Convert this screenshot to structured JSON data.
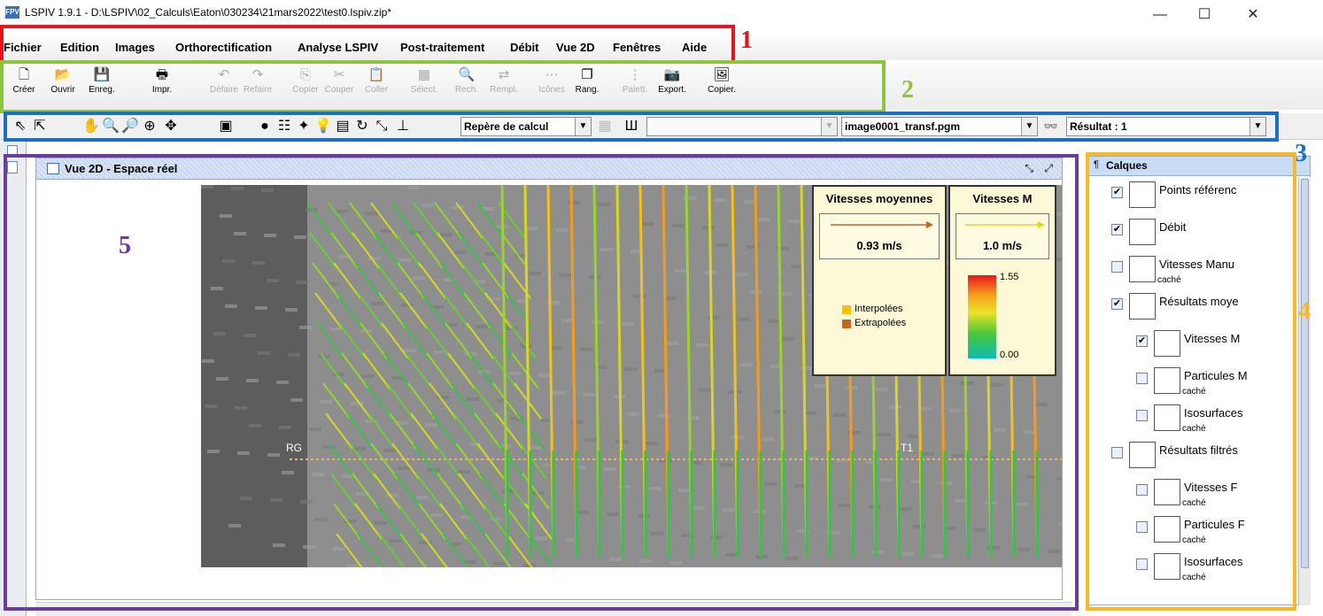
{
  "window": {
    "title": "LSPIV 1.9.1 - D:\\LSPIV\\02_Calculs\\Eaton\\030234\\21mars2022\\test0.lspiv.zip*",
    "logo_text": "FPV",
    "minimize": "—",
    "maximize": "☐",
    "close": "✕"
  },
  "menu": [
    "Fichier",
    "Edition",
    "Images",
    "Orthorectification",
    "Analyse LSPIV",
    "Post-traitement",
    "Débit",
    "Vue 2D",
    "Fenêtres",
    "Aide"
  ],
  "toolbar": [
    {
      "label": "Créer",
      "icon": "new-file-icon",
      "glyph": "🗋",
      "enabled": true
    },
    {
      "label": "Ouvrir",
      "icon": "open-folder-icon",
      "glyph": "📂",
      "enabled": true
    },
    {
      "label": "Enreg.",
      "icon": "save-icon",
      "glyph": "💾",
      "enabled": true
    },
    {
      "label": "Impr.",
      "icon": "print-icon",
      "glyph": "🖶",
      "enabled": true
    },
    {
      "label": "Défaire",
      "icon": "undo-icon",
      "glyph": "↶",
      "enabled": false
    },
    {
      "label": "Refaire",
      "icon": "redo-icon",
      "glyph": "↷",
      "enabled": false
    },
    {
      "label": "Copier",
      "icon": "copy-icon",
      "glyph": "⎘",
      "enabled": false
    },
    {
      "label": "Couper",
      "icon": "cut-icon",
      "glyph": "✂",
      "enabled": false
    },
    {
      "label": "Coller",
      "icon": "paste-icon",
      "glyph": "📋",
      "enabled": false
    },
    {
      "label": "Sélect.",
      "icon": "select-all-icon",
      "glyph": "▦",
      "enabled": false
    },
    {
      "label": "Rech.",
      "icon": "search-icon",
      "glyph": "🔍",
      "enabled": false
    },
    {
      "label": "Rempl.",
      "icon": "replace-icon",
      "glyph": "⇄",
      "enabled": false
    },
    {
      "label": "Icônes",
      "icon": "icons-icon",
      "glyph": "⋯",
      "enabled": false
    },
    {
      "label": "Rang.",
      "icon": "arrange-icon",
      "glyph": "❐",
      "enabled": true
    },
    {
      "label": "Palett.",
      "icon": "palette-icon",
      "glyph": "⋮",
      "enabled": false
    },
    {
      "label": "Export.",
      "icon": "export-icon",
      "glyph": "📷",
      "enabled": true
    },
    {
      "label": "Copier.",
      "icon": "copy-image-icon",
      "glyph": "🖼",
      "enabled": true
    }
  ],
  "toolbar2": {
    "icons": [
      "select-arrow-icon",
      "select-multi-icon",
      "hand-pick-icon",
      "zoom-in-icon",
      "zoom-out-icon",
      "zoom-fit-icon",
      "pan-icon",
      "window-icon",
      "sphere-icon",
      "list-icon",
      "tools-icon",
      "bulb-icon",
      "page-icon",
      "refresh-icon",
      "move-icon",
      "axis-icon"
    ],
    "glyphs": [
      "⇖",
      "⇱",
      "✋",
      "🔍",
      "🔎",
      "⊕",
      "✥",
      "▣",
      "●",
      "☷",
      "✦",
      "💡",
      "▤",
      "↻",
      "⤡",
      "⊥"
    ],
    "repere_value": "Repère de calcul",
    "empty_combo": "",
    "image_value": "image0001_transf.pgm",
    "result_value": "Résultat : 1",
    "glasses_glyph": "👓",
    "scale_glyph": "Ш"
  },
  "view": {
    "title": "Vue 2D - Espace réel",
    "label_rg": "RG",
    "label_t1": "T1",
    "legend_mean": {
      "title": "Vitesses moyennes",
      "value": "0.93 m/s",
      "interp": "Interpolées",
      "extrap": "Extrapolées",
      "interp_color": "#f4c20d",
      "extrap_color": "#c8641b"
    },
    "legend_m": {
      "title": "Vitesses M",
      "value": "1.0 m/s",
      "max": "1.55",
      "min": "0.00"
    }
  },
  "calques": {
    "title": "Calques",
    "layers": [
      {
        "name": "Points référenc",
        "sub": "",
        "checked": true
      },
      {
        "name": "Débit",
        "sub": "",
        "checked": true
      },
      {
        "name": "Vitesses Manu",
        "sub": "caché",
        "checked": false
      },
      {
        "name": "Résultats moye",
        "sub": "",
        "checked": true
      },
      {
        "name": "Vitesses M",
        "sub": "",
        "checked": true
      },
      {
        "name": "Particules M",
        "sub": "caché",
        "checked": false
      },
      {
        "name": "Isosurfaces",
        "sub": "caché",
        "checked": false
      },
      {
        "name": "Résultats filtrés",
        "sub": "",
        "checked": false
      },
      {
        "name": "Vitesses F",
        "sub": "caché",
        "checked": false
      },
      {
        "name": "Particules F",
        "sub": "caché",
        "checked": false
      },
      {
        "name": "Isosurfaces",
        "sub": "caché",
        "checked": false
      }
    ]
  },
  "annotations": {
    "n1": "1",
    "n2": "2",
    "n3": "3",
    "n4": "4",
    "n5": "5",
    "c1": "#e8141c",
    "c2": "#8cc63f",
    "c3": "#1a6fc4",
    "c4": "#f7b924",
    "c5": "#6a3c9c"
  }
}
